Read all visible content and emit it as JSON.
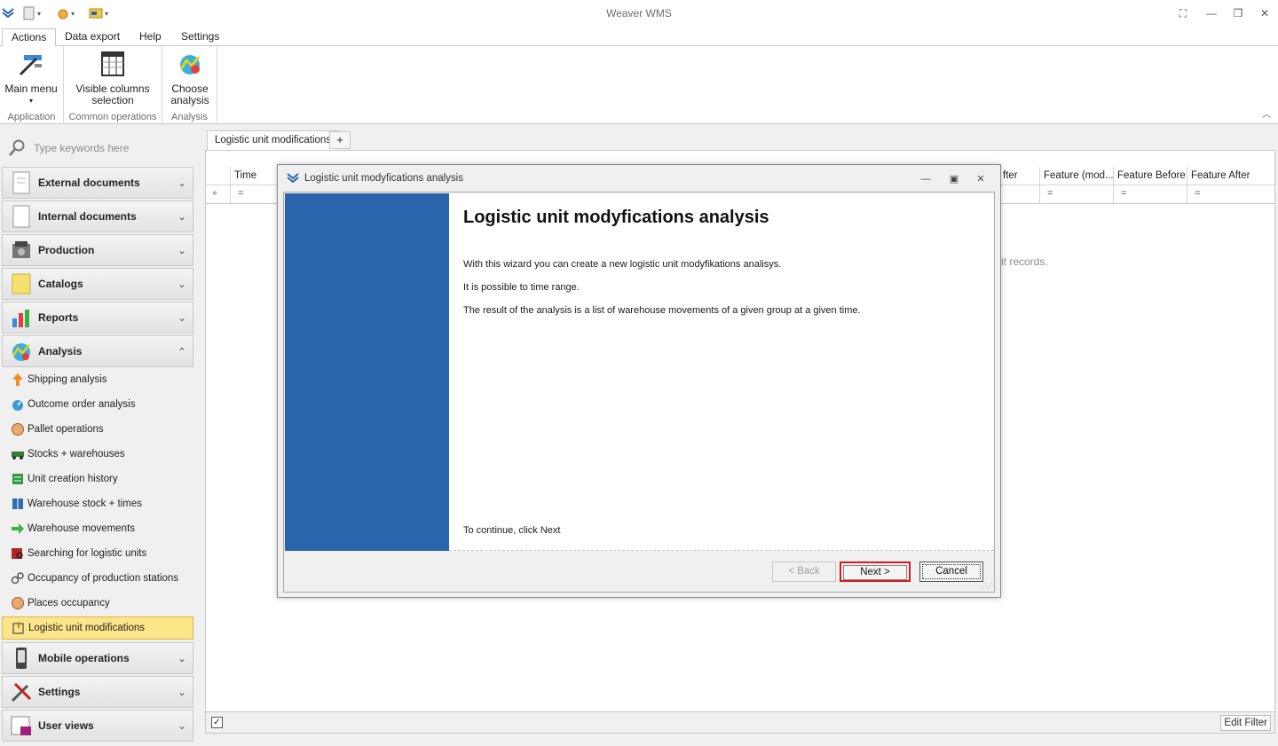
{
  "app": {
    "title": "Weaver WMS"
  },
  "ribbon": {
    "tabs": [
      "Actions",
      "Data export",
      "Help",
      "Settings"
    ],
    "groups": [
      {
        "label": "Application",
        "buttons": [
          {
            "label1": "Main menu",
            "label2": "▾",
            "icon": "main-menu-icon"
          }
        ]
      },
      {
        "label": "Common operations",
        "buttons": [
          {
            "label1": "Visible columns",
            "label2": "selection",
            "icon": "columns-icon"
          }
        ]
      },
      {
        "label": "Analysis",
        "buttons": [
          {
            "label1": "Choose",
            "label2": "analysis",
            "icon": "analysis-icon"
          }
        ]
      }
    ]
  },
  "sidebar": {
    "search_placeholder": "Type keywords here",
    "groups_top": [
      {
        "label": "External documents",
        "icon": "document-icon"
      },
      {
        "label": "Internal documents",
        "icon": "document-icon"
      },
      {
        "label": "Production",
        "icon": "production-icon"
      },
      {
        "label": "Catalogs",
        "icon": "catalog-icon"
      },
      {
        "label": "Reports",
        "icon": "reports-icon"
      },
      {
        "label": "Analysis",
        "icon": "analysis-icon",
        "expanded": true
      }
    ],
    "items": [
      {
        "label": "Shipping analysis",
        "color": "#f08c28"
      },
      {
        "label": "Outcome order analysis",
        "color": "#3a9ad9"
      },
      {
        "label": "Pallet operations",
        "color": "#d9884a"
      },
      {
        "label": "Stocks + warehouses",
        "color": "#2e7d32"
      },
      {
        "label": "Unit creation history",
        "color": "#2e9d42"
      },
      {
        "label": "Warehouse stock + times",
        "color": "#2f6fb0"
      },
      {
        "label": "Warehouse movements",
        "color": "#3cb043"
      },
      {
        "label": "Searching for logistic units",
        "color": "#b02828"
      },
      {
        "label": "Occupancy of production stations",
        "color": "#555555"
      },
      {
        "label": "Places occupancy",
        "color": "#d9884a"
      },
      {
        "label": "Logistic unit modifications",
        "color": "#8a6d1a",
        "selected": true
      }
    ],
    "groups_bottom": [
      {
        "label": "Mobile operations",
        "icon": "mobile-icon"
      },
      {
        "label": "Settings",
        "icon": "tools-icon"
      },
      {
        "label": "User views",
        "icon": "user-views-icon"
      }
    ]
  },
  "main": {
    "doc_tab": "Logistic unit modifications",
    "add_tab": "+",
    "columns": [
      "Time",
      "fter",
      "Feature (mod...",
      "Feature Before",
      "Feature After"
    ],
    "filter_symbol": "=",
    "no_records": "it records.",
    "edit_filter": "Edit Filter"
  },
  "dialog": {
    "title": "Logistic unit modyfications analysis",
    "heading": "Logistic unit modyfications analysis",
    "paragraphs": [
      "With this wizard you can create a new logistic unit modyfikations analisys.",
      "It is possible to time range.",
      "The result of the analysis is a list of warehouse movements of a given group at a given time."
    ],
    "continue_text": "To continue, click Next",
    "back_label": "< Back",
    "next_label": "Next >",
    "cancel_label": "Cancel",
    "side_color": "#2a64ac"
  }
}
